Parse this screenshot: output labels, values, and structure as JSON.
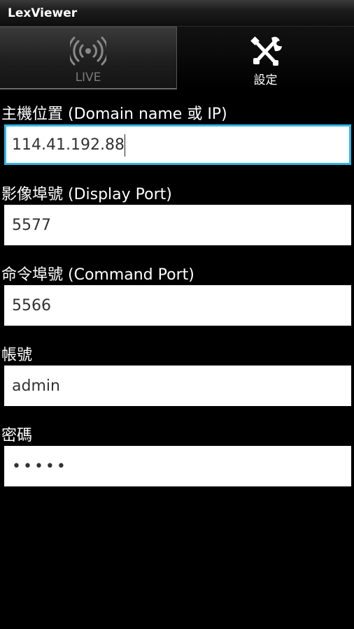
{
  "app": {
    "title": "LexViewer"
  },
  "tabs": [
    {
      "label": "LIVE",
      "icon": "broadcast-icon",
      "selected": false
    },
    {
      "label": "設定",
      "icon": "tools-icon",
      "selected": true
    }
  ],
  "form": {
    "host": {
      "label": "主機位置 (Domain name 或 IP)",
      "value": "114.41.192.88"
    },
    "display_port": {
      "label": "影像埠號 (Display Port)",
      "value": "5577"
    },
    "command_port": {
      "label": "命令埠號 (Command Port)",
      "value": "5566"
    },
    "account": {
      "label": "帳號",
      "value": "admin"
    },
    "password": {
      "label": "密碼",
      "value": "admin"
    }
  },
  "colors": {
    "focus_accent": "#34b5e5",
    "background": "#000000"
  }
}
